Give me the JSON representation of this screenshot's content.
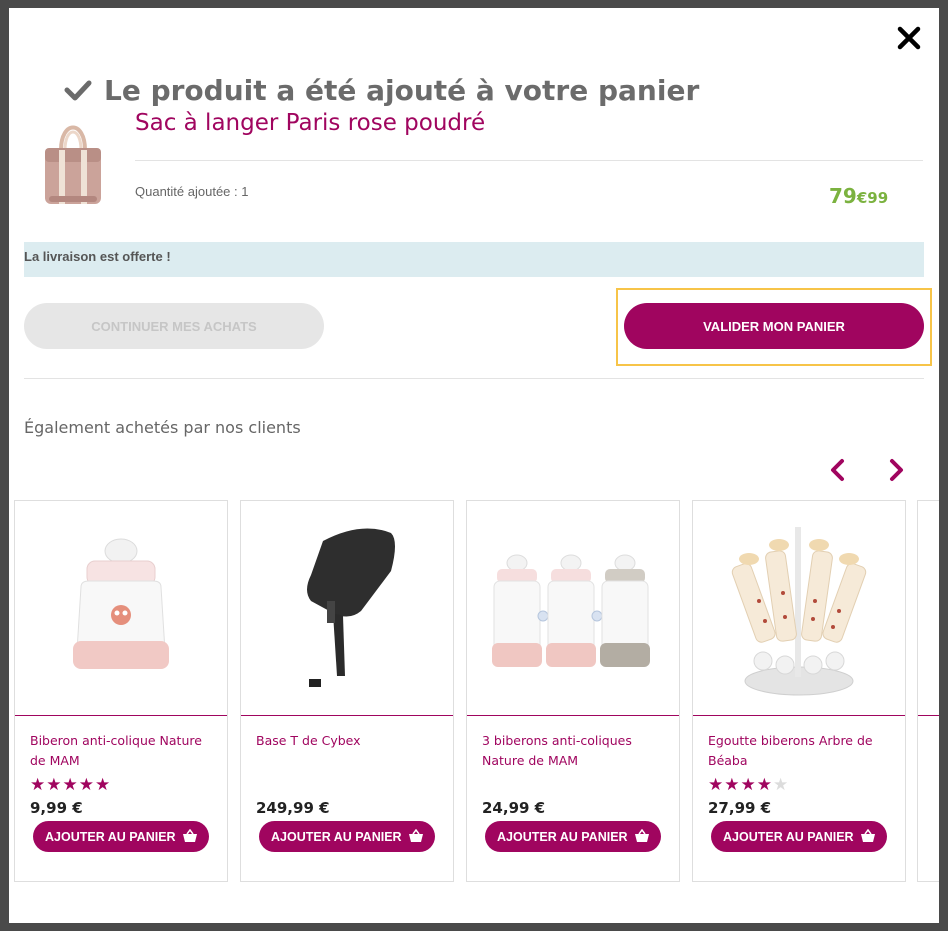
{
  "modal": {
    "close_label": "close",
    "added_title": "Le produit a été ajouté à votre panier",
    "product": {
      "name": "Sac à langer Paris rose poudré",
      "quantity_text": "Quantité ajoutée : 1",
      "price_int": "79",
      "price_cents": "€99"
    },
    "shipping_notice": "La livraison est offerte !",
    "continue_button": "CONTINUER MES ACHATS",
    "validate_button": "VALIDER MON PANIER"
  },
  "recommendations": {
    "title": "Également achetés par nos clients",
    "products": [
      {
        "name": "Biberon anti-colique Nature de MAM",
        "rating": 5,
        "price": "9,99 €",
        "button": "AJOUTER AU PANIER"
      },
      {
        "name": "Base T de Cybex",
        "rating": 0,
        "price": "249,99 €",
        "button": "AJOUTER AU PANIER"
      },
      {
        "name": "3 biberons anti-coliques Nature de MAM",
        "rating": 0,
        "price": "24,99 €",
        "button": "AJOUTER AU PANIER"
      },
      {
        "name": "Egoutte biberons Arbre de Béaba",
        "rating": 4,
        "price": "27,99 €",
        "button": "AJOUTER AU PANIER"
      }
    ]
  },
  "colors": {
    "brand": "#a0055f",
    "price_green": "#7bb23f",
    "shipping_bg": "#dcecf0",
    "highlight_frame": "#f7c448"
  },
  "icons": [
    "close-icon",
    "check-icon",
    "chevron-left-icon",
    "chevron-right-icon",
    "basket-icon",
    "star-icon"
  ]
}
